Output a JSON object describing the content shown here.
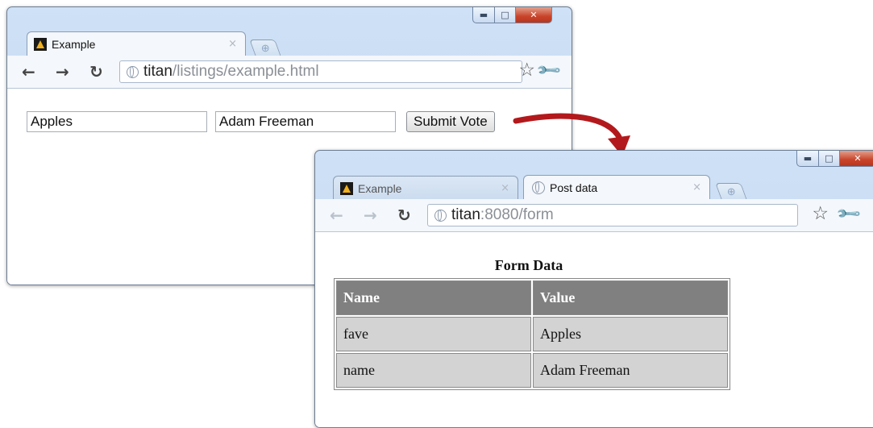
{
  "window1": {
    "tabs": [
      {
        "title": "Example",
        "active": true
      }
    ],
    "address": {
      "host": "titan",
      "path": "/listings/example.html"
    },
    "form": {
      "fave_value": "Apples",
      "name_value": "Adam Freeman",
      "submit_label": "Submit Vote"
    }
  },
  "window2": {
    "tabs": [
      {
        "title": "Example",
        "active": false
      },
      {
        "title": "Post data",
        "active": true
      }
    ],
    "address": {
      "host": "titan",
      "path": ":8080/form"
    },
    "caption": "Form Data",
    "table": {
      "headers": [
        "Name",
        "Value"
      ],
      "rows": [
        [
          "fave",
          "Apples"
        ],
        [
          "name",
          "Adam Freeman"
        ]
      ]
    }
  },
  "colors": {
    "arrow": "#b3191c",
    "header_bg": "#808080",
    "cell_bg": "#d3d3d3",
    "close_button": "#c8432a"
  },
  "icons": [
    "minimize-icon",
    "maximize-icon",
    "close-icon",
    "new-tab-icon",
    "back-arrow-icon",
    "forward-arrow-icon",
    "reload-icon",
    "globe-icon",
    "bookmark-star-icon",
    "wrench-icon",
    "curved-arrow-icon"
  ]
}
